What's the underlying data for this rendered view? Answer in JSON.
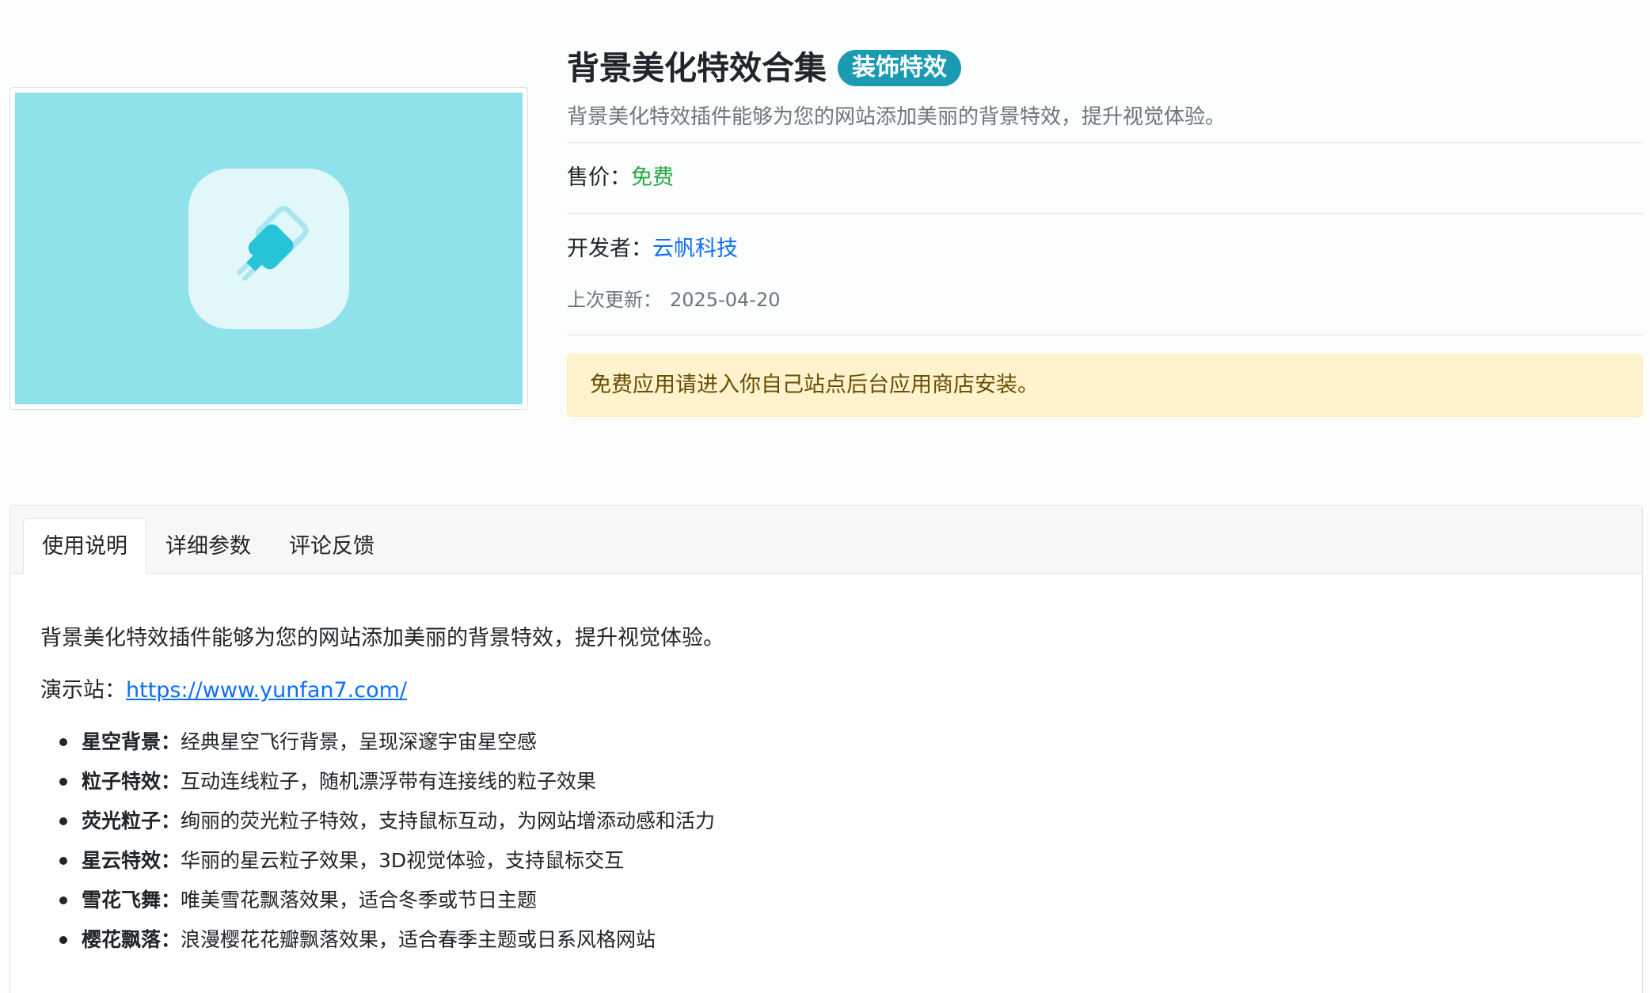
{
  "product": {
    "name": "背景美化特效合集",
    "category_badge": "装饰特效",
    "description": "背景美化特效插件能够为您的网站添加美丽的背景特效，提升视觉体验。",
    "thumbnail_icon": "plug-icon"
  },
  "price": {
    "label": "售价：",
    "value": "免费"
  },
  "developer": {
    "label": "开发者：",
    "name": "云帆科技"
  },
  "updated": {
    "label": "上次更新：",
    "date": "2025-04-20"
  },
  "notice": "免费应用请进入你自己站点后台应用商店安装。",
  "tabs": [
    {
      "label": "使用说明",
      "active": true
    },
    {
      "label": "详细参数",
      "active": false
    },
    {
      "label": "评论反馈",
      "active": false
    }
  ],
  "usage": {
    "intro": "背景美化特效插件能够为您的网站添加美丽的背景特效，提升视觉体验。",
    "demo_label": "演示站：",
    "demo_url": "https://www.yunfan7.com/",
    "features": [
      {
        "name": "星空背景：",
        "text": "经典星空飞行背景，呈现深邃宇宙星空感"
      },
      {
        "name": "粒子特效：",
        "text": "互动连线粒子，随机漂浮带有连接线的粒子效果"
      },
      {
        "name": "荧光粒子：",
        "text": "绚丽的荧光粒子特效，支持鼠标互动，为网站增添动感和活力"
      },
      {
        "name": "星云特效：",
        "text": "华丽的星云粒子效果，3D视觉体验，支持鼠标交互"
      },
      {
        "name": "雪花飞舞：",
        "text": "唯美雪花飘落效果，适合冬季或节日主题"
      },
      {
        "name": "樱花飘落：",
        "text": "浪漫樱花花瓣飘落效果，适合春季主题或日系风格网站"
      }
    ]
  },
  "colors": {
    "thumbnail_bg": "#90e2ea",
    "badge_bg": "#1a9bb1",
    "free_text": "#28a745",
    "link": "#0d6efd",
    "notice_bg": "#fff3cd"
  }
}
